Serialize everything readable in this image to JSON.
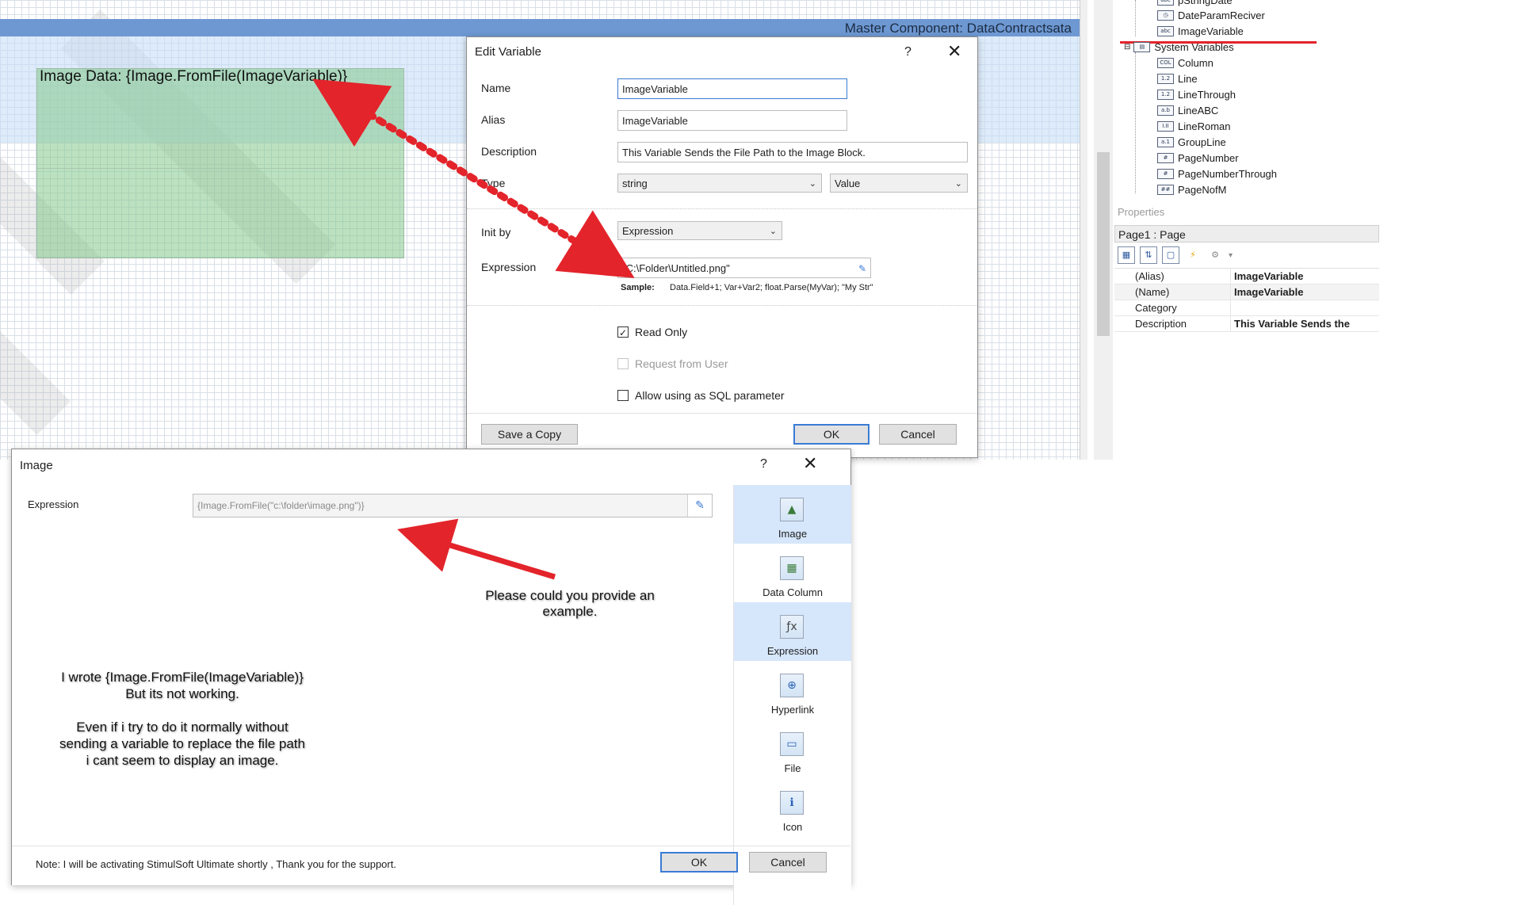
{
  "canvas": {
    "band_title": "Master Component: DataContractsata",
    "image_data_text": "Image Data: {Image.FromFile(ImageVariable)}"
  },
  "tree": {
    "top_items": [
      {
        "label": "pStringDate",
        "icon": "abc"
      },
      {
        "label": "DateParamReciver",
        "icon": "clock"
      },
      {
        "label": "ImageVariable",
        "icon": "abc"
      }
    ],
    "system_group": "System Variables",
    "system_items": [
      {
        "label": "Column",
        "icon": "COL"
      },
      {
        "label": "Line",
        "icon": "1.2"
      },
      {
        "label": "LineThrough",
        "icon": "1.2"
      },
      {
        "label": "LineABC",
        "icon": "a.b"
      },
      {
        "label": "LineRoman",
        "icon": "I.II"
      },
      {
        "label": "GroupLine",
        "icon": "a.1"
      },
      {
        "label": "PageNumber",
        "icon": "#"
      },
      {
        "label": "PageNumberThrough",
        "icon": "#"
      },
      {
        "label": "PageNofM",
        "icon": "##"
      }
    ]
  },
  "properties": {
    "section_label": "Properties",
    "header": "Page1 : Page",
    "rows": [
      {
        "name": "(Alias)",
        "value": "ImageVariable"
      },
      {
        "name": "(Name)",
        "value": "ImageVariable"
      },
      {
        "name": "Category",
        "value": ""
      },
      {
        "name": "Description",
        "value": "This Variable Sends the"
      }
    ]
  },
  "edit_variable": {
    "title": "Edit Variable",
    "help": "?",
    "close": "✕",
    "name_label": "Name",
    "name_value": "ImageVariable",
    "alias_label": "Alias",
    "alias_value": "ImageVariable",
    "description_label": "Description",
    "description_value": "This Variable Sends the File Path to the Image Block.",
    "type_label": "Type",
    "type_value": "string",
    "kind_value": "Value",
    "init_by_label": "Init by",
    "init_by_value": "Expression",
    "expression_label": "Expression",
    "expression_value": "\"C:\\Folder\\Untitled.png\"",
    "sample_label": "Sample:",
    "sample_text": "Data.Field+1; Var+Var2; float.Parse(MyVar); \"My Str\"",
    "read_only_label": "Read Only",
    "request_from_user_label": "Request from User",
    "allow_sql_label": "Allow using as SQL parameter",
    "save_copy_label": "Save a Copy",
    "ok_label": "OK",
    "cancel_label": "Cancel"
  },
  "image_dialog": {
    "title": "Image",
    "help": "?",
    "close": "✕",
    "expression_label": "Expression",
    "expression_value": "{Image.FromFile(\"c:\\folder\\image.png\")}",
    "sources": [
      {
        "label": "Image",
        "icon": "image-icon"
      },
      {
        "label": "Data Column",
        "icon": "data-column-icon"
      },
      {
        "label": "Expression",
        "icon": "expression-icon"
      },
      {
        "label": "Hyperlink",
        "icon": "hyperlink-icon"
      },
      {
        "label": "File",
        "icon": "file-icon"
      },
      {
        "label": "Icon",
        "icon": "icon-icon"
      }
    ],
    "note": "Note: I will be activating StimulSoft Ultimate shortly , Thank you for the support.",
    "ok_label": "OK",
    "cancel_label": "Cancel"
  },
  "annotations": {
    "request": "Please could you provide an example.",
    "problem_line1": "I wrote {Image.FromFile(ImageVariable)}",
    "problem_line2": "But its not working.",
    "problem_line3": "Even if i try to do it normally without",
    "problem_line4": "sending a variable to replace the file path",
    "problem_line5": "i cant seem to display an image."
  },
  "colors": {
    "accent": "#3a7bd5",
    "annotation_red": "#e3242b",
    "band": "#6e98d2",
    "image_block": "#84c88c"
  }
}
